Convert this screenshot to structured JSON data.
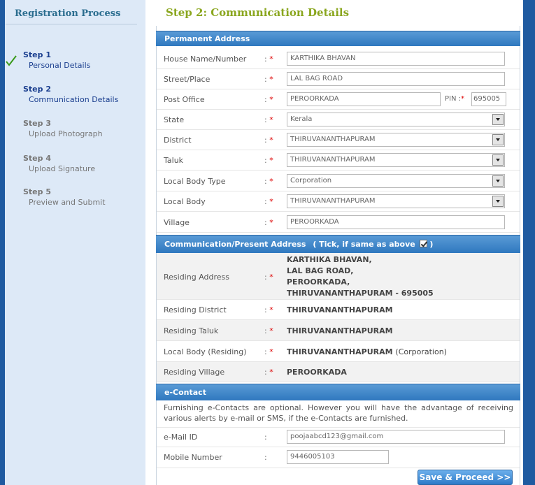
{
  "sidebar": {
    "title": "Registration Process",
    "steps": [
      {
        "num": "Step 1",
        "label": "Personal Details",
        "done": true
      },
      {
        "num": "Step 2",
        "label": "Communication Details",
        "active": true
      },
      {
        "num": "Step 3",
        "label": "Upload Photograph"
      },
      {
        "num": "Step 4",
        "label": "Upload Signature"
      },
      {
        "num": "Step 5",
        "label": "Preview and Submit"
      }
    ]
  },
  "main": {
    "title": "Step 2: Communication Details"
  },
  "permanent": {
    "header": "Permanent Address",
    "required_mark": "*",
    "colon": ":",
    "house_label": "House Name/Number",
    "house_value": "KARTHIKA BHAVAN",
    "street_label": "Street/Place",
    "street_value": "LAL BAG ROAD",
    "post_label": "Post Office",
    "post_value": "PEROORKADA",
    "pin_label": "PIN :",
    "pin_value": "695005",
    "state_label": "State",
    "state_value": "Kerala",
    "district_label": "District",
    "district_value": "THIRUVANANTHAPURAM",
    "taluk_label": "Taluk",
    "taluk_value": "THIRUVANANTHAPURAM",
    "lbtype_label": "Local Body Type",
    "lbtype_value": "Corporation",
    "lb_label": "Local Body",
    "lb_value": "THIRUVANANTHAPURAM",
    "village_label": "Village",
    "village_value": "PEROORKADA"
  },
  "present": {
    "header": "Communication/Present Address",
    "tick_label": "( Tick, if same as above",
    "tick_close": ")",
    "addr_label": "Residing Address",
    "addr_line1": "KARTHIKA BHAVAN,",
    "addr_line2": "LAL BAG ROAD,",
    "addr_line3": "PEROORKADA,",
    "addr_line4": "THIRUVANANTHAPURAM - 695005",
    "district_label": "Residing District",
    "district_value": "THIRUVANANTHAPURAM",
    "taluk_label": "Residing Taluk",
    "taluk_value": "THIRUVANANTHAPURAM",
    "lb_label": "Local Body (Residing)",
    "lb_value": "THIRUVANANTHAPURAM",
    "lb_type": "(Corporation)",
    "village_label": "Residing Village",
    "village_value": "PEROORKADA"
  },
  "econtact": {
    "header": "e-Contact",
    "notice": "Furnishing e-Contacts are optional. However you will have the advantage of receiving various alerts by e-mail or SMS, if the e-Contacts are furnished.",
    "email_label": "e-Mail ID",
    "email_value": "poojaabcd123@gmail.com",
    "mobile_label": "Mobile Number",
    "mobile_value": "9446005103"
  },
  "save_button": "Save & Proceed >>"
}
